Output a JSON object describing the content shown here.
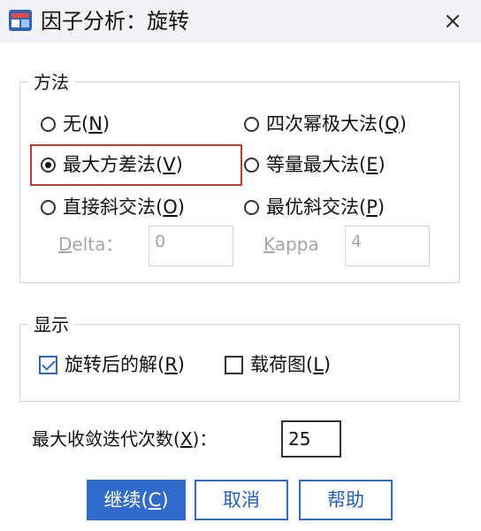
{
  "window": {
    "title": "因子分析：旋转",
    "close_symbol": "×"
  },
  "method_group": {
    "label": "方法",
    "options": [
      {
        "label": "无(",
        "key": "N",
        "suffix": ")",
        "selected": false
      },
      {
        "label": "四次幂极大法(",
        "key": "Q",
        "suffix": ")",
        "selected": false
      },
      {
        "label": "最大方差法(",
        "key": "V",
        "suffix": ")",
        "selected": true
      },
      {
        "label": "等量最大法(",
        "key": "E",
        "suffix": ")",
        "selected": false
      },
      {
        "label": "直接斜交法(",
        "key": "O",
        "suffix": ")",
        "selected": false
      },
      {
        "label": "最优斜交法(",
        "key": "P",
        "suffix": ")",
        "selected": false
      }
    ],
    "delta": {
      "key": "D",
      "rest": "elta：",
      "value": "0"
    },
    "kappa": {
      "key": "K",
      "rest": "appa",
      "value": "4"
    }
  },
  "display_group": {
    "label": "显示",
    "rotated_solution": {
      "label": "旋转后的解(",
      "key": "R",
      "suffix": ")",
      "checked": true
    },
    "loading_plot": {
      "label": "载荷图(",
      "key": "L",
      "suffix": ")",
      "checked": false
    }
  },
  "iterations": {
    "label": "最大收敛迭代次数(",
    "key": "X",
    "suffix": ")：",
    "value": "25"
  },
  "buttons": {
    "continue": {
      "label": "继续(",
      "key": "C",
      "suffix": ")"
    },
    "cancel": "取消",
    "help": "帮助"
  },
  "colors": {
    "accent": "#2f6bc8",
    "focus_border": "#c23b32",
    "disabled_text": "#a6a6a6"
  }
}
